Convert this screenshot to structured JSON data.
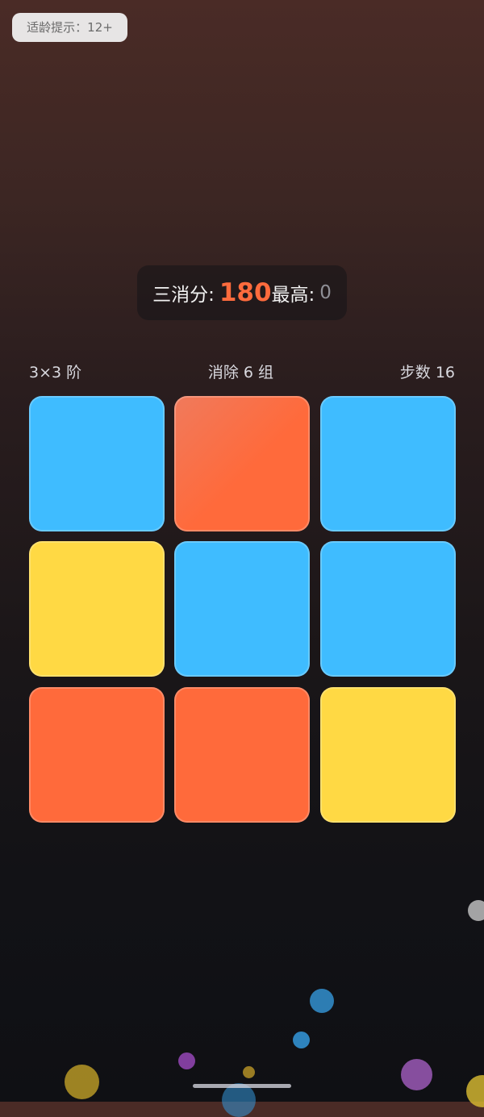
{
  "status": {
    "age_notice": "适龄提示：12+"
  },
  "score": {
    "label": "三消分:",
    "value": "180",
    "best_label": "最高:",
    "best_value": "0"
  },
  "info": {
    "grid_size": "3×3 阶",
    "cleared": "消除 6 组",
    "steps": "步数 16"
  },
  "board": {
    "rows": 3,
    "cols": 3,
    "tiles": [
      [
        "blue",
        "orange",
        "blue"
      ],
      [
        "yellow",
        "blue",
        "blue"
      ],
      [
        "orange",
        "orange",
        "yellow"
      ]
    ]
  },
  "colors": {
    "blue": "#3fbcff",
    "orange": "#ff6a3b",
    "yellow": "#ffd944",
    "score_accent": "#ff6b3d"
  },
  "decorations": {
    "orbs": [
      "white",
      "blue",
      "blue",
      "purple",
      "yellow",
      "purple",
      "yellow",
      "blue",
      "yellow"
    ]
  }
}
